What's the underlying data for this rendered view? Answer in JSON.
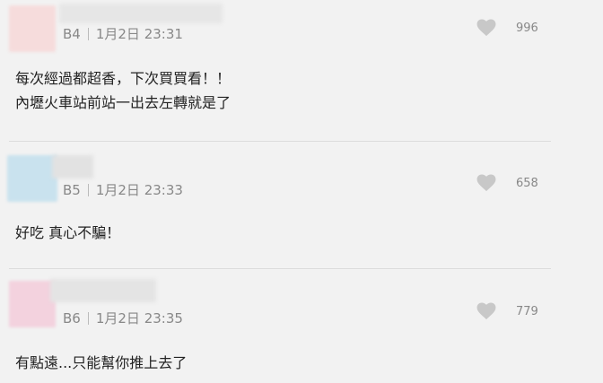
{
  "comments": [
    {
      "floor": "B4",
      "time": "1月2日 23:31",
      "likes": "996",
      "lines": [
        "每次經過都超香，下次買買看！！",
        "內壢火車站前站一出去左轉就是了"
      ],
      "avatar_color": "#f6dcdc",
      "name_color": "#e6e6e6"
    },
    {
      "floor": "B5",
      "time": "1月2日 23:33",
      "likes": "658",
      "lines": [
        "好吃 真心不騙！"
      ],
      "avatar_color": "#c9e2ee",
      "name_color": "#e2e2e2"
    },
    {
      "floor": "B6",
      "time": "1月2日 23:35",
      "likes": "779",
      "lines": [
        "有點遠...只能幫你推上去了"
      ],
      "avatar_color": "#f3d2de",
      "name_color": "#e4e4e4"
    }
  ],
  "icons": {
    "like": "heart-icon"
  },
  "colors": {
    "heart": "#c8c8c8",
    "meta_text": "#888888",
    "divider": "#dcdcdc"
  }
}
